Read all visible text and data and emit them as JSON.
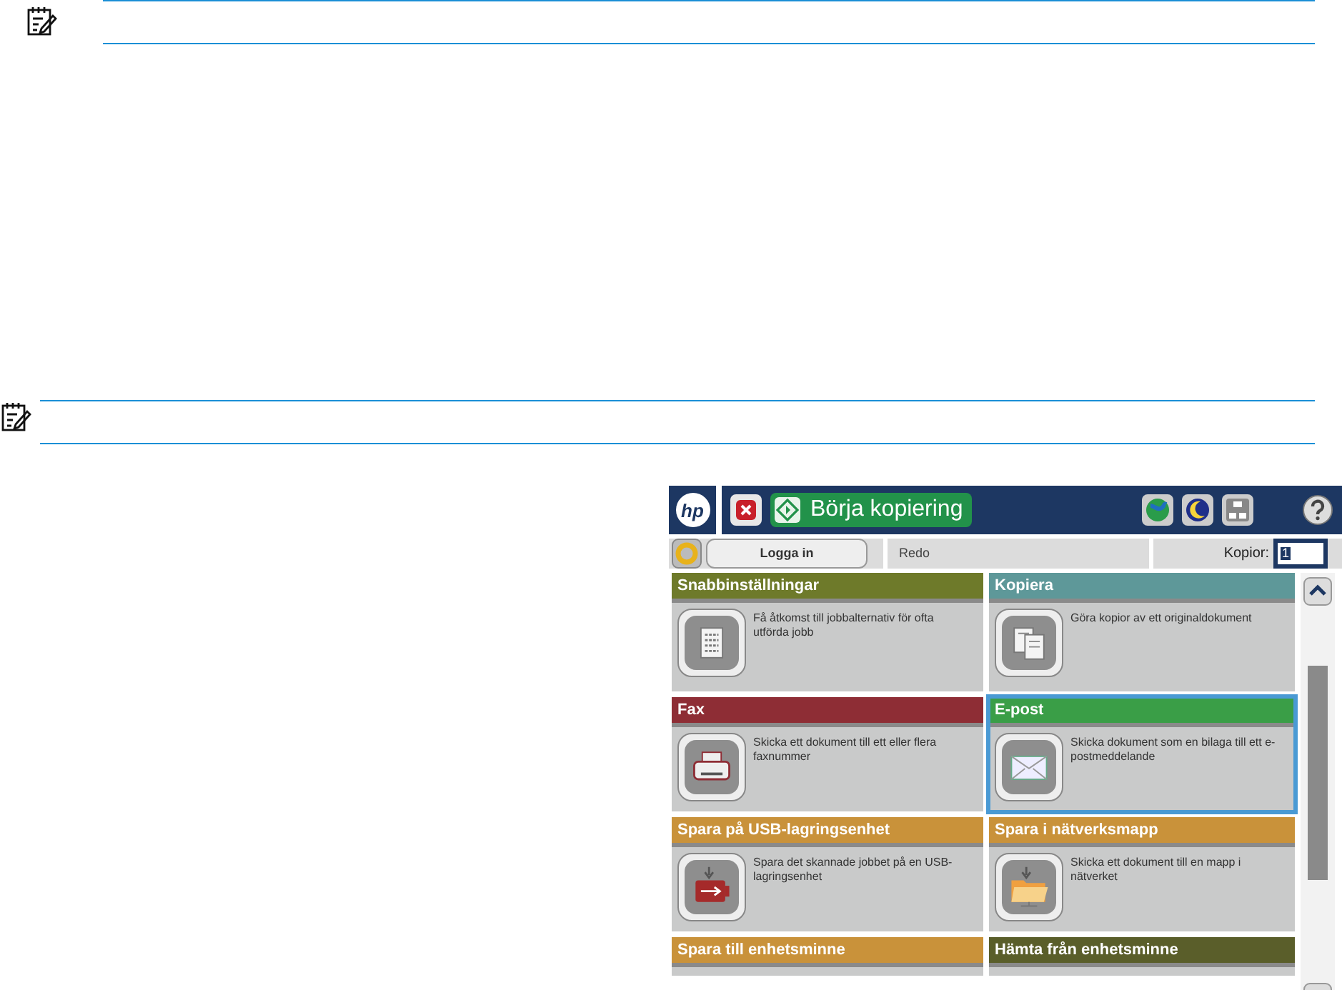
{
  "panel": {
    "logo": "hp",
    "start_button": "Börja kopiering",
    "login_button": "Logga in",
    "status": "Redo",
    "copies_label": "Kopior:",
    "copies_value": "1",
    "tiles": [
      {
        "title": "Snabbinställningar",
        "color": "#6e7a2a",
        "description": "Få åtkomst till jobbalternativ för ofta utförda jobb",
        "kind": "list",
        "selected": false
      },
      {
        "title": "Kopiera",
        "color": "#5e9899",
        "description": "Göra kopior av ett originaldokument",
        "kind": "copy",
        "selected": false
      },
      {
        "title": "Fax",
        "color": "#8e2d35",
        "description": "Skicka ett dokument till ett eller flera faxnummer",
        "kind": "printer",
        "selected": false
      },
      {
        "title": "E-post",
        "color": "#3a9e47",
        "description": "Skicka dokument som en bilaga till ett e-postmeddelande",
        "kind": "envelope",
        "selected": true
      },
      {
        "title": "Spara på USB-lagringsenhet",
        "color": "#c9923a",
        "description": "Spara det skannade jobbet på en USB-lagringsenhet",
        "kind": "usb",
        "selected": false
      },
      {
        "title": "Spara i nätverksmapp",
        "color": "#c9923a",
        "description": "Skicka ett dokument till en mapp i nätverket",
        "kind": "folder",
        "selected": false
      },
      {
        "title": "Spara till enhetsminne",
        "color": "#c9923a",
        "selected": false
      },
      {
        "title": "Hämta från enhetsminne",
        "color": "#5a5e2a",
        "selected": false
      }
    ]
  }
}
